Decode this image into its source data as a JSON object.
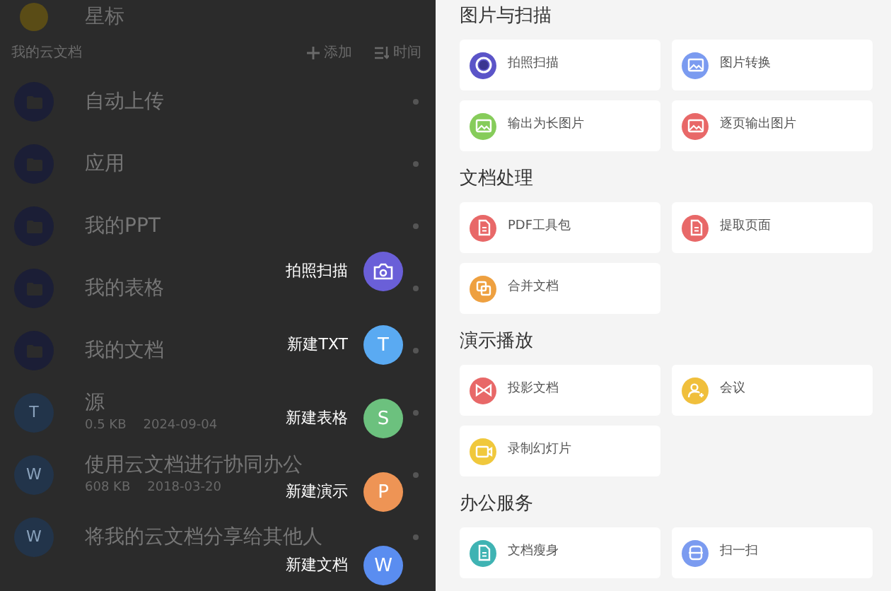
{
  "file_panel": {
    "starred": {
      "label": "星标"
    },
    "header": {
      "title": "我的云文档",
      "add": "添加",
      "sort": "时间"
    },
    "items": [
      {
        "kind": "folder",
        "name": "自动上传"
      },
      {
        "kind": "folder",
        "name": "应用"
      },
      {
        "kind": "folder",
        "name": "我的PPT"
      },
      {
        "kind": "folder",
        "name": "我的表格"
      },
      {
        "kind": "folder",
        "name": "我的文档"
      },
      {
        "kind": "file",
        "badge": "T",
        "name": "源",
        "size": "0.5 KB",
        "date": "2024-09-04"
      },
      {
        "kind": "file",
        "badge": "W",
        "name": "使用云文档进行协同办公",
        "size": "608 KB",
        "date": "2018-03-20"
      },
      {
        "kind": "file",
        "badge": "W",
        "name": "将我的云文档分享给其他人"
      }
    ]
  },
  "new_menu": [
    {
      "kind": "camera",
      "label": "拍照扫描",
      "color": "#6a5fd8"
    },
    {
      "kind": "letter",
      "badge": "T",
      "label": "新建TXT",
      "color": "#5aaaf2"
    },
    {
      "kind": "letter",
      "badge": "S",
      "label": "新建表格",
      "color": "#6cc17e"
    },
    {
      "kind": "letter",
      "badge": "P",
      "label": "新建演示",
      "color": "#ee9455"
    },
    {
      "kind": "letter",
      "badge": "W",
      "label": "新建文档",
      "color": "#5a8df0"
    }
  ],
  "tool_panel": {
    "sections": [
      {
        "title": "图片与扫描",
        "tools": [
          {
            "label": "拍照扫描",
            "color": "#5b54c8"
          },
          {
            "label": "图片转换",
            "color": "#7b9bf0"
          },
          {
            "label": "输出为长图片",
            "color": "#86cc5a"
          },
          {
            "label": "逐页输出图片",
            "color": "#e86868"
          }
        ]
      },
      {
        "title": "文档处理",
        "tools": [
          {
            "label": "PDF工具包",
            "color": "#e86868"
          },
          {
            "label": "提取页面",
            "color": "#e86868"
          },
          {
            "label": "合并文档",
            "color": "#eea040"
          }
        ]
      },
      {
        "title": "演示播放",
        "tools": [
          {
            "label": "投影文档",
            "color": "#e86868"
          },
          {
            "label": "会议",
            "color": "#f0bf3c"
          },
          {
            "label": "录制幻灯片",
            "color": "#f0c83c"
          }
        ]
      },
      {
        "title": "办公服务",
        "tools": [
          {
            "label": "文档瘦身",
            "color": "#3fb3b3"
          },
          {
            "label": "扫一扫",
            "color": "#7b9bf0"
          }
        ]
      }
    ]
  }
}
